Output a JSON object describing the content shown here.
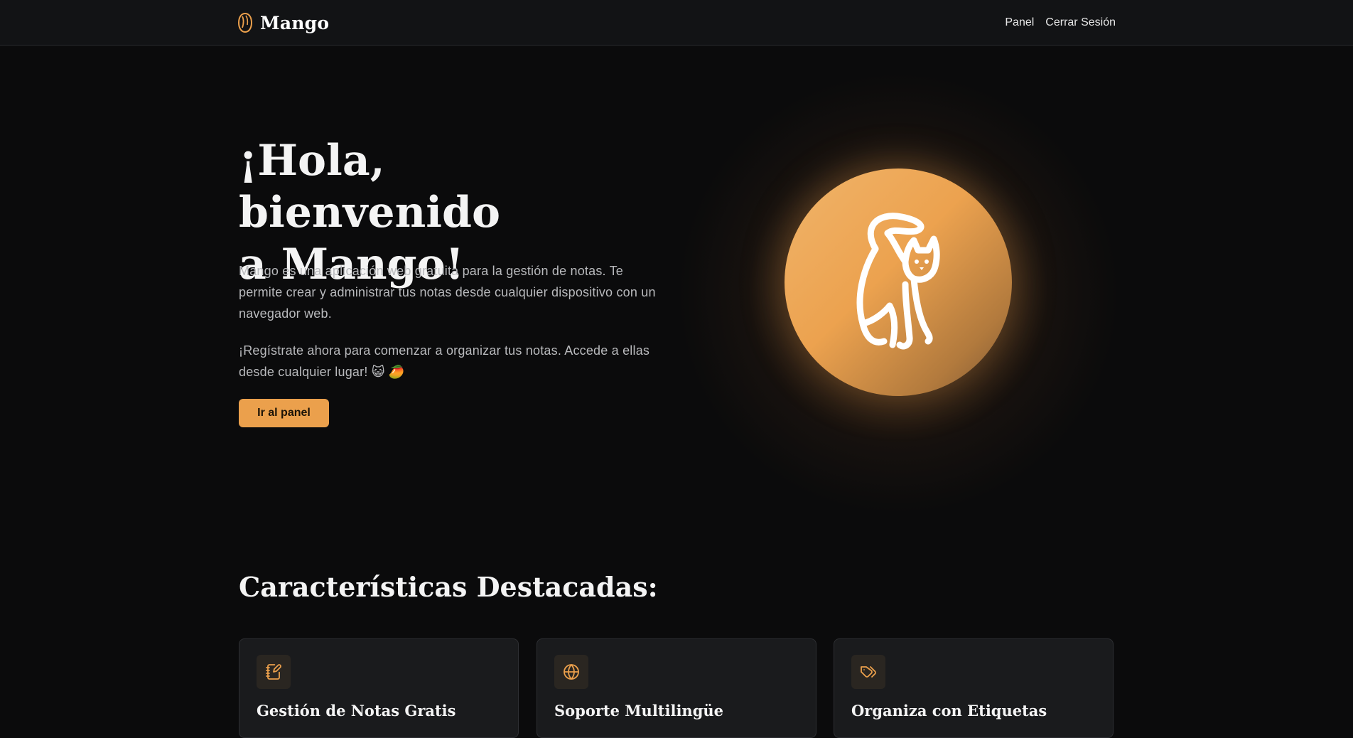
{
  "header": {
    "brand_name": "Mango",
    "brand_icon": "mango-icon",
    "nav": [
      {
        "label": "Panel"
      },
      {
        "label": "Cerrar Sesión"
      }
    ]
  },
  "hero": {
    "title_line1": "¡Hola, bienvenido",
    "title_line2": "a Mango!",
    "paragraph1": "Mango es una aplicación web gratuita para la gestión de notas. Te permite crear y administrar tus notas desde cualquier dispositivo con un navegador web.",
    "paragraph2": "¡Regístrate ahora para comenzar a organizar tus notas. Accede a ellas desde cualquier lugar! 😺 🥭",
    "cta_label": "Ir al panel",
    "illustration_icon": "cat-icon"
  },
  "features": {
    "title": "Características Destacadas:",
    "cards": [
      {
        "title": "Gestión de Notas Gratis",
        "icon": "notebook-pen-icon"
      },
      {
        "title": "Soporte Multilingüe",
        "icon": "globe-icon"
      },
      {
        "title": "Organiza con Etiquetas",
        "icon": "tags-icon"
      }
    ]
  },
  "colors": {
    "accent": "#eba04c",
    "background": "#0b0b0c",
    "header_bg": "#121315",
    "card_bg": "#1a1b1d"
  }
}
